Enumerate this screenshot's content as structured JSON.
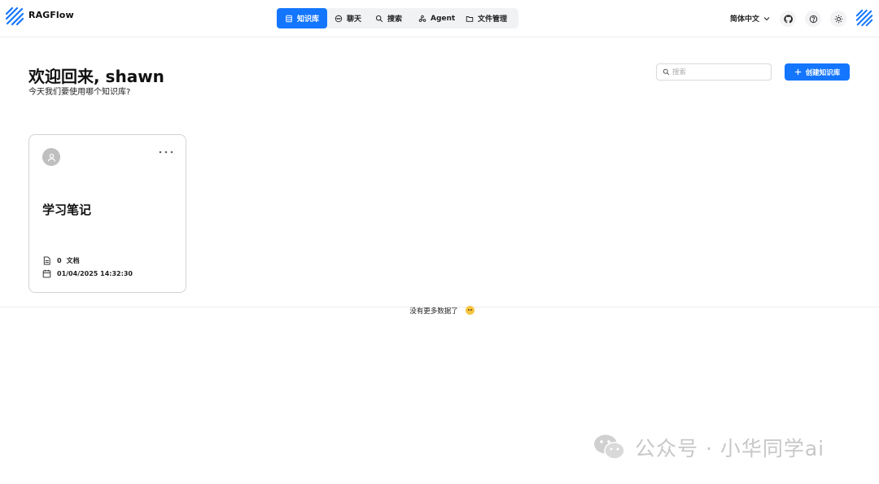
{
  "header": {
    "brand": "RAGFlow",
    "nav": [
      {
        "label": "知识库",
        "icon": "database-icon",
        "active": true
      },
      {
        "label": "聊天",
        "icon": "chat-icon",
        "active": false
      },
      {
        "label": "搜索",
        "icon": "search-icon",
        "active": false
      },
      {
        "label": "Agent",
        "icon": "agent-icon",
        "active": false
      },
      {
        "label": "文件管理",
        "icon": "folder-icon",
        "active": false
      }
    ],
    "language": "简体中文",
    "icons": [
      "github-icon",
      "help-icon",
      "theme-sun-icon",
      "user-avatar-icon"
    ]
  },
  "main": {
    "welcome": "欢迎回来, shawn",
    "subtitle": "今天我们要使用哪个知识库?",
    "search_placeholder": "搜索",
    "create_label": "创建知识库"
  },
  "knowledge_bases": [
    {
      "title": "学习笔记",
      "doc_count": "0",
      "doc_label": "文档",
      "date": "01/04/2025 14:32:30"
    }
  ],
  "footer": {
    "no_more": "没有更多数据了"
  },
  "watermark": "公众号 · 小华同学ai",
  "colors": {
    "accent": "#1476ff",
    "nav_bg": "#f1f2f4",
    "border": "#d3d3d6"
  }
}
